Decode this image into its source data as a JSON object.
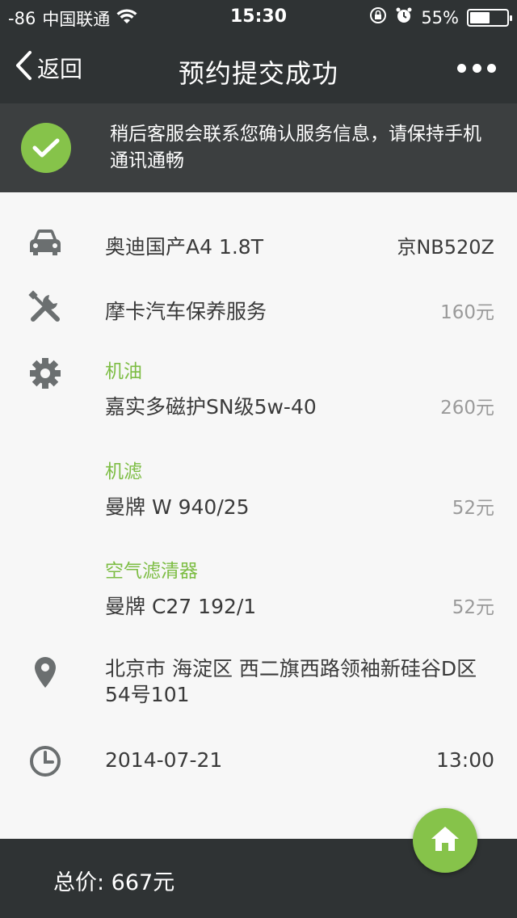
{
  "status_bar": {
    "signal": "-86",
    "carrier": "中国联通",
    "time": "15:30",
    "battery": "55%",
    "battery_level": 0.55
  },
  "nav": {
    "back_label": "返回",
    "title": "预约提交成功"
  },
  "notice": {
    "message": "稍后客服会联系您确认服务信息，请保持手机通讯通畅"
  },
  "vehicle": {
    "model": "奥迪国产A4 1.8T",
    "plate": "京NB520Z"
  },
  "service": {
    "name": "摩卡汽车保养服务",
    "price": "160元"
  },
  "parts": [
    {
      "category": "机油",
      "name": "嘉实多磁护SN级5w-40",
      "price": "260元"
    },
    {
      "category": "机滤",
      "name": "曼牌 W 940/25",
      "price": "52元"
    },
    {
      "category": "空气滤清器",
      "name": "曼牌 C27 192/1",
      "price": "52元"
    }
  ],
  "address": "北京市 海淀区 西二旗西路领袖新硅谷D区54号101",
  "appointment": {
    "date": "2014-07-21",
    "time": "13:00"
  },
  "footer": {
    "total": "总价: 667元"
  },
  "colors": {
    "accent": "#86c34a",
    "dark": "#2f3334",
    "label_green": "#7dbd44"
  }
}
